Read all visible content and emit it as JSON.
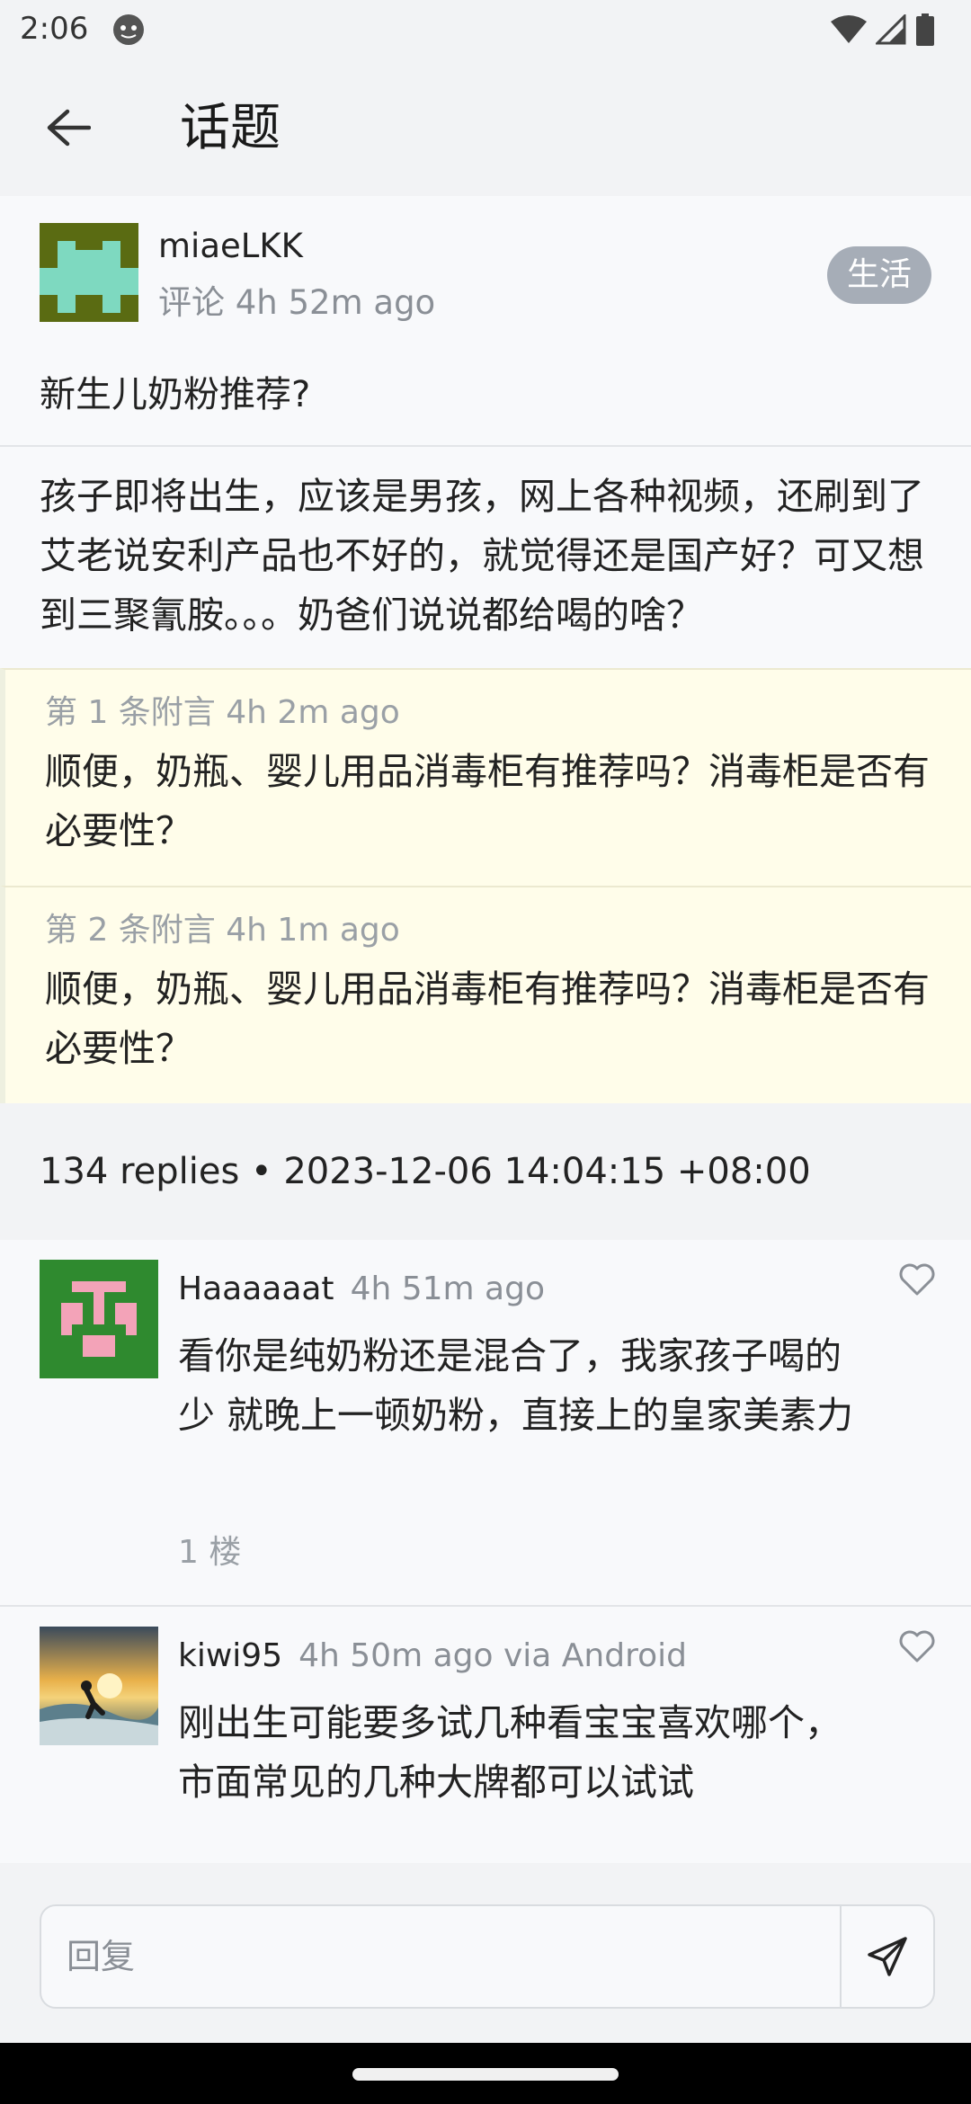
{
  "status": {
    "time": "2:06"
  },
  "appbar": {
    "title": "话题"
  },
  "topic": {
    "user": "miaeLKK",
    "meta": "评论 4h 52m ago",
    "tag": "生活",
    "title": "新生儿奶粉推荐?",
    "body": "孩子即将出生，应该是男孩，网上各种视频，还刷到了艾老说安利产品也不好的，就觉得还是国产好？可又想到三聚氰胺。。。奶爸们说说都给喝的啥？"
  },
  "addenda": [
    {
      "meta": "第 1 条附言 4h 2m ago",
      "body": "顺便，奶瓶、婴儿用品消毒柜有推荐吗？消毒柜是否有必要性？"
    },
    {
      "meta": "第 2 条附言 4h 1m ago",
      "body": "顺便，奶瓶、婴儿用品消毒柜有推荐吗？消毒柜是否有必要性？"
    }
  ],
  "summary": "134 replies  •  2023-12-06 14:04:15 +08:00",
  "replies": [
    {
      "user": "Haaaaaat",
      "time": "4h 51m ago",
      "text": "看你是纯奶粉还是混合了，我家孩子喝的少 就晚上一顿奶粉，直接上的皇家美素力",
      "floor": "1 楼"
    },
    {
      "user": "kiwi95",
      "time": "4h 50m ago via Android",
      "text": "刚出生可能要多试几种看宝宝喜欢哪个，市面常见的几种大牌都可以试试"
    }
  ],
  "compose": {
    "placeholder": "回复"
  },
  "colors": {
    "addendum_bg": "#fffdea",
    "tag_bg": "#a6adb7",
    "avatar1_bg": "#5a6b12",
    "avatar1_fg": "#7ed9c0",
    "avatar2_bg": "#2f8a2f",
    "avatar2_fg": "#f3a3b8"
  },
  "icons": [
    "back-arrow-icon",
    "heart-icon",
    "send-icon",
    "wifi-icon",
    "signal-icon",
    "battery-icon",
    "assistant-face-icon"
  ]
}
